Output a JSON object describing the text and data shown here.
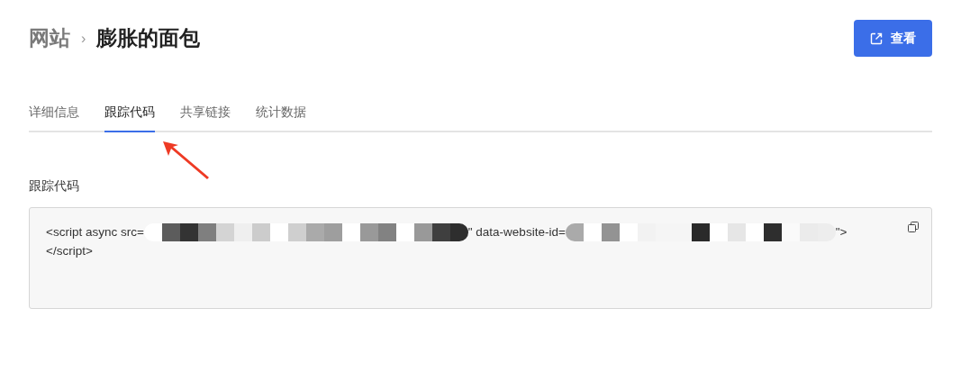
{
  "breadcrumb": {
    "parent": "网站",
    "separator": "›",
    "current": "膨胀的面包"
  },
  "view_button": {
    "label": "查看"
  },
  "tabs": [
    {
      "label": "详细信息",
      "selected": false
    },
    {
      "label": "跟踪代码",
      "selected": true
    },
    {
      "label": "共享链接",
      "selected": false
    },
    {
      "label": "统计数据",
      "selected": false
    }
  ],
  "tracking_code": {
    "label": "跟踪代码",
    "lines": [
      [
        {
          "kind": "text",
          "text": "<script async src="
        },
        {
          "kind": "redacted"
        },
        {
          "kind": "text",
          "text": "\" data-website-id="
        },
        {
          "kind": "redacted"
        },
        {
          "kind": "text",
          "text": "\">"
        }
      ],
      [
        {
          "kind": "text",
          "text": "</script>"
        }
      ]
    ]
  }
}
